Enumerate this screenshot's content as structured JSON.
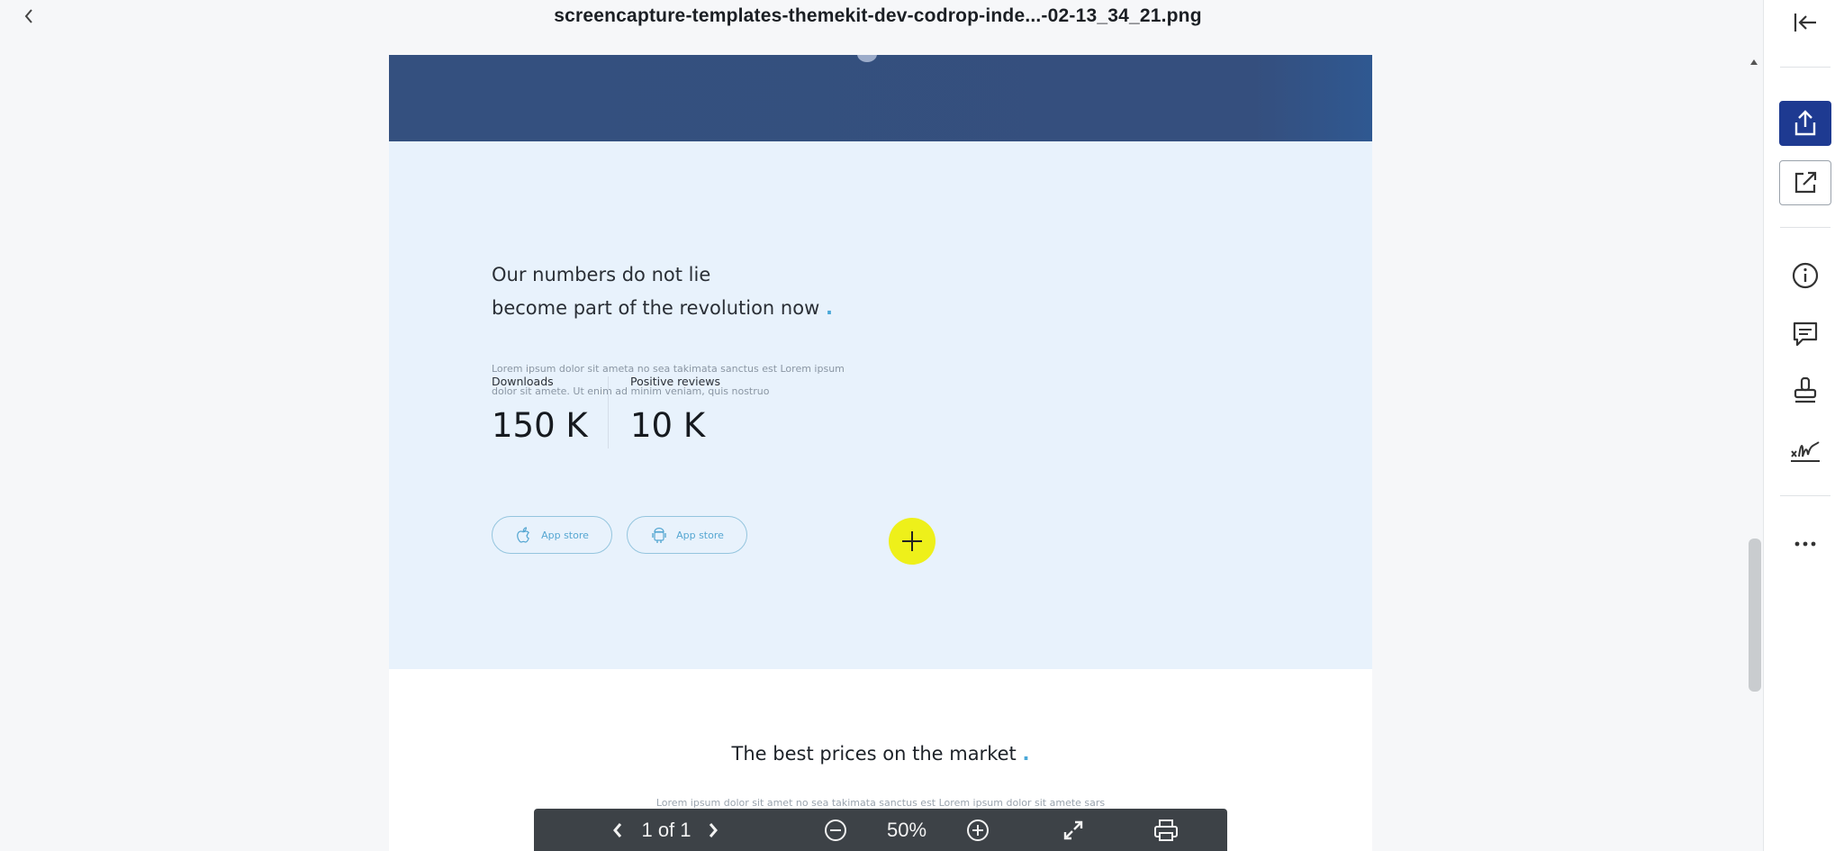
{
  "window": {
    "title": "screencapture-templates-themekit-dev-codrop-inde...-02-13_34_21.png",
    "back_icon": "chevron-left-icon"
  },
  "document": {
    "stats_section": {
      "headline_line1": "Our numbers do not lie",
      "headline_line2": "become part of the revolution now",
      "headline_dot": ".",
      "body_line1": "Lorem ipsum dolor sit ameta no sea takimata sanctus est Lorem ipsum",
      "body_line2": "dolor sit amete. Ut enim ad minim veniam, quis nostruo",
      "stats": [
        {
          "label": "Downloads",
          "value": "150 K"
        },
        {
          "label": "Positive reviews",
          "value": "10 K"
        }
      ],
      "buttons": [
        {
          "label": "App store",
          "icon": "apple-icon"
        },
        {
          "label": "App store",
          "icon": "android-icon"
        }
      ]
    },
    "prices_section": {
      "title": "The best prices on the market",
      "title_dot": ".",
      "subtitle": "Lorem ipsum dolor sit amet no sea takimata sanctus est Lorem ipsum dolor sit amete sars"
    }
  },
  "toolbar": {
    "page_indicator": "1 of 1",
    "zoom": "50%",
    "icons": [
      "prev-page-icon",
      "next-page-icon",
      "zoom-out-icon",
      "zoom-in-icon",
      "fit-screen-icon",
      "print-icon"
    ]
  },
  "sidebar": {
    "items": [
      "collapse-panel-icon",
      "share-icon",
      "open-external-icon",
      "info-icon",
      "comment-icon",
      "stamp-icon",
      "signature-icon",
      "more-icon"
    ]
  },
  "colors": {
    "accent": "#1e3a91",
    "hero_band": "#34507f",
    "stats_background": "#e8f2fc",
    "cursor_highlight": "#eef01a"
  }
}
